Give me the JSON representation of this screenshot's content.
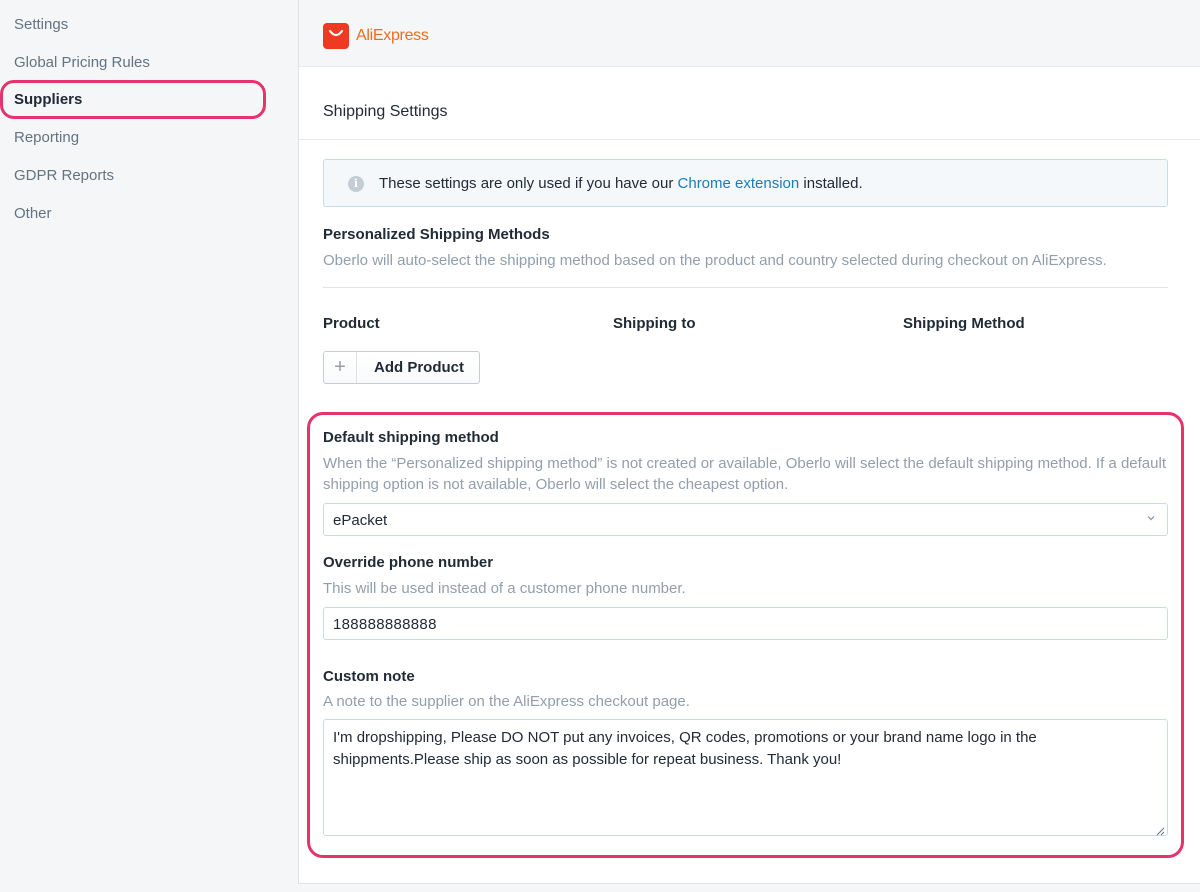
{
  "sidebar": {
    "items": [
      {
        "label": "Settings"
      },
      {
        "label": "Global Pricing Rules"
      },
      {
        "label": "Suppliers"
      },
      {
        "label": "Reporting"
      },
      {
        "label": "GDPR Reports"
      },
      {
        "label": "Other"
      }
    ],
    "active": "Suppliers"
  },
  "header": {
    "logo_text": "AliExpress",
    "logo_icon": "shopping-bag-icon"
  },
  "shipping": {
    "title": "Shipping Settings",
    "banner": {
      "icon": "info-icon",
      "text_before": "These settings are only used if you have our ",
      "link": "Chrome extension",
      "text_after": " installed."
    },
    "personalized": {
      "label": "Personalized Shipping Methods",
      "help": "Oberlo will auto-select the shipping method based on the product and country selected during checkout on AliExpress."
    },
    "table_headers": [
      "Product",
      "Shipping to",
      "Shipping Method"
    ],
    "add_product_label": "Add Product",
    "default_method": {
      "label": "Default shipping method",
      "help": "When the “Personalized shipping method” is not created or available, Oberlo will select the default shipping method. If a default shipping option is not available, Oberlo will select the cheapest option.",
      "value": "ePacket"
    },
    "phone": {
      "label": "Override phone number",
      "help": "This will be used instead of a customer phone number.",
      "value": "188888888888"
    },
    "note": {
      "label": "Custom note",
      "help": "A note to the supplier on the AliExpress checkout page.",
      "value": "I'm dropshipping, Please DO NOT put any invoices, QR codes, promotions or your brand name logo in the shippments.Please ship as soon as possible for repeat business. Thank you!"
    }
  },
  "colors": {
    "highlight": "#e6336c",
    "link": "#1f7ab8",
    "brand": "#ee3a22"
  }
}
